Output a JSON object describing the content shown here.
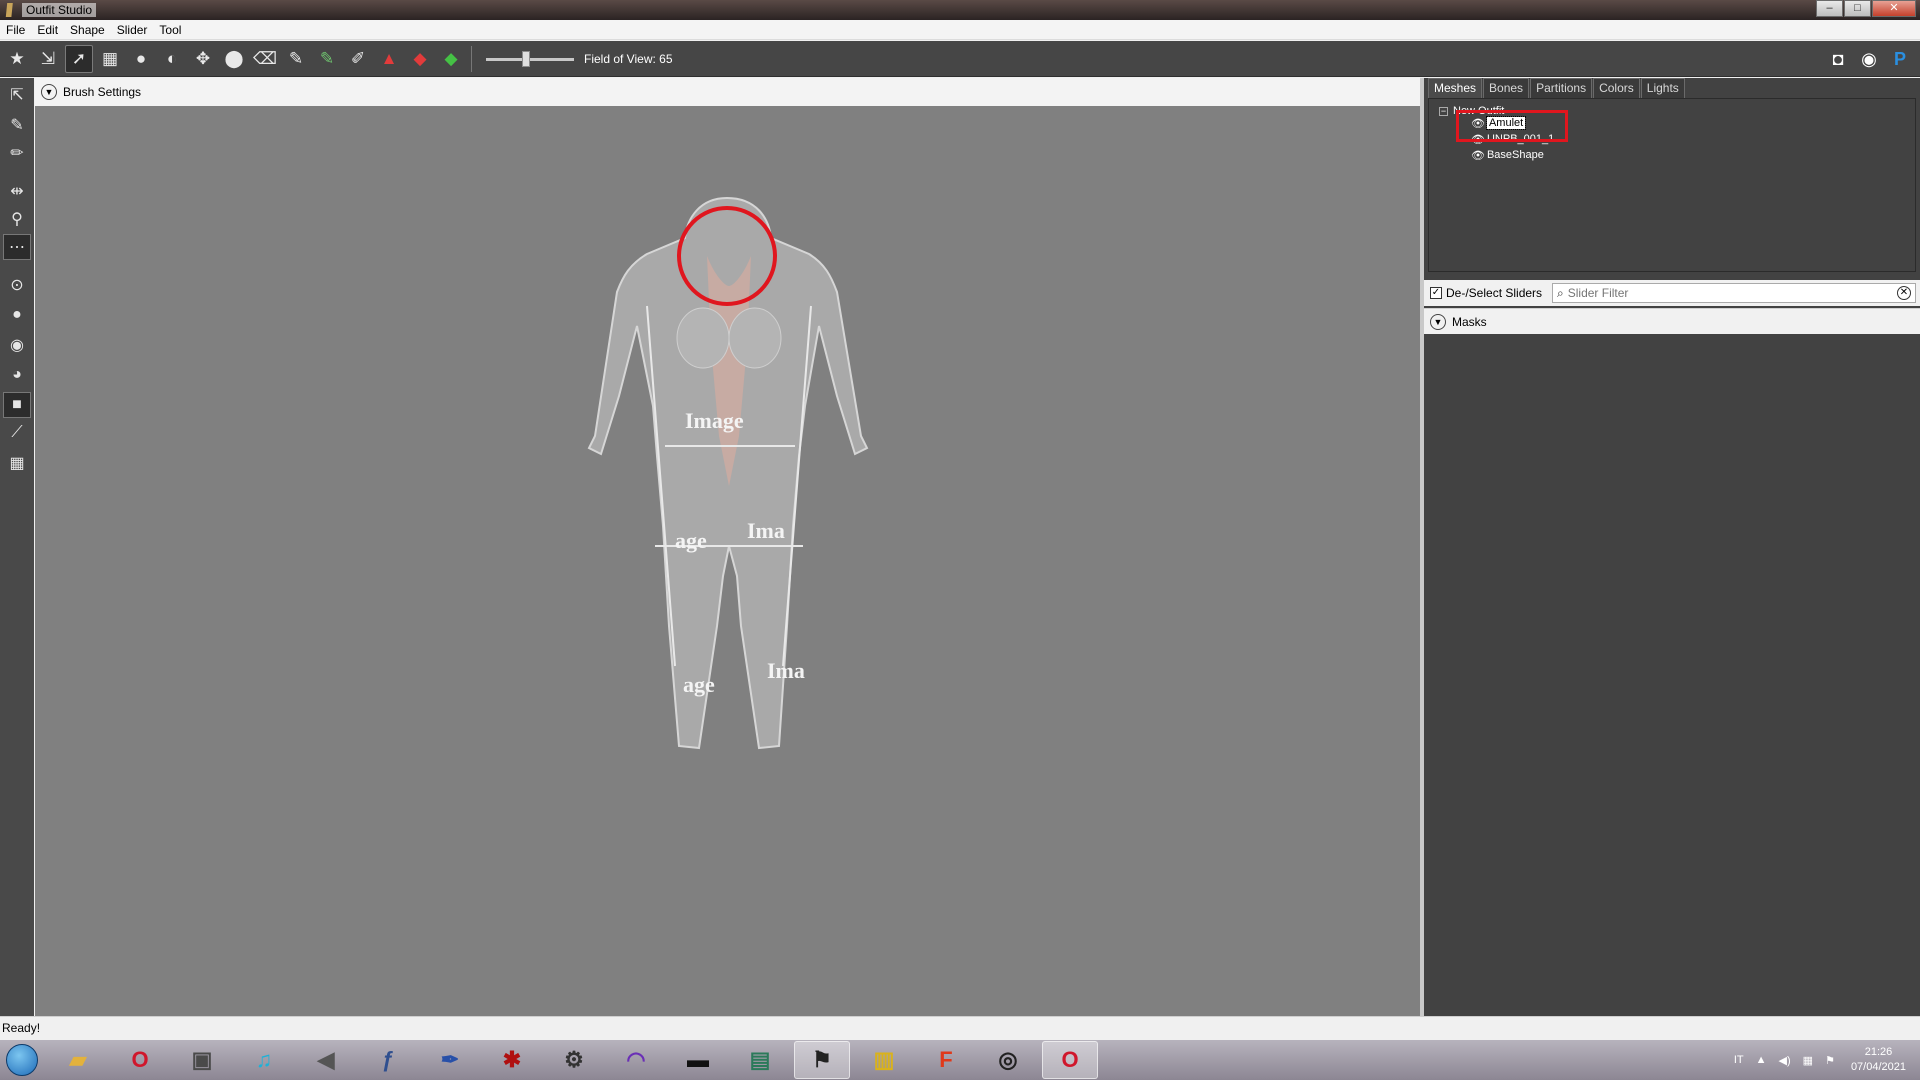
{
  "window": {
    "title": "Outfit Studio",
    "min": "–",
    "max": "□",
    "close": "✕"
  },
  "menu": [
    "File",
    "Edit",
    "Shape",
    "Slider",
    "Tool"
  ],
  "toolbar": {
    "field_of_view_label": "Field of View: 65",
    "field_of_view_value": 65,
    "icons": [
      "load-project-icon",
      "save-project-icon",
      "select-brush-icon",
      "mask-brush-icon",
      "inflate-brush-icon",
      "deflate-brush-icon",
      "move-brush-icon",
      "smooth-brush-icon",
      "undiff-brush-icon",
      "weight-brush-icon",
      "color-brush-icon",
      "alpha-brush-icon",
      "transform-icon",
      "pivot-icon",
      "vertex-select-icon"
    ]
  },
  "toolbar_right_icons": [
    "discord-icon",
    "github-icon",
    "paypal-icon"
  ],
  "left_tools": [
    "select-tool-icon",
    "pin-tool-icon",
    "brush-tool-icon",
    "mirror-x-icon",
    "bone-tool-icon",
    "points-icon",
    "dot-small-icon",
    "dot-medium-icon",
    "dot-large-icon",
    "sphere-icon",
    "cube-icon",
    "wire-icon",
    "grid-icon"
  ],
  "brush_settings": {
    "label": "Brush Settings"
  },
  "tabs": [
    "Meshes",
    "Bones",
    "Partitions",
    "Colors",
    "Lights"
  ],
  "tree": {
    "root": "New Outfit",
    "items": [
      {
        "label": "Amulet",
        "selected": true
      },
      {
        "label": "UNPB_001_1",
        "selected": false
      },
      {
        "label": "BaseShape",
        "selected": false
      }
    ]
  },
  "sliders": {
    "deselect_label": "De-/Select Sliders",
    "deselect_checked": true,
    "filter_placeholder": "Slider Filter",
    "filter_value": "",
    "masks_label": "Masks"
  },
  "status": {
    "text": "Ready!"
  },
  "taskbar": {
    "apps": [
      "explorer",
      "opera",
      "media",
      "music",
      "sound",
      "ffdec",
      "feather",
      "spider",
      "tools",
      "headphones",
      "nmm",
      "outfit-studio",
      "folder-manager",
      "foobar",
      "creation-kit",
      "opera"
    ],
    "lang": "IT",
    "time": "21:26",
    "date": "07/04/2021"
  },
  "colors": {
    "highlight": "#e0161e",
    "viewport": "#808080",
    "panel": "#424242"
  }
}
